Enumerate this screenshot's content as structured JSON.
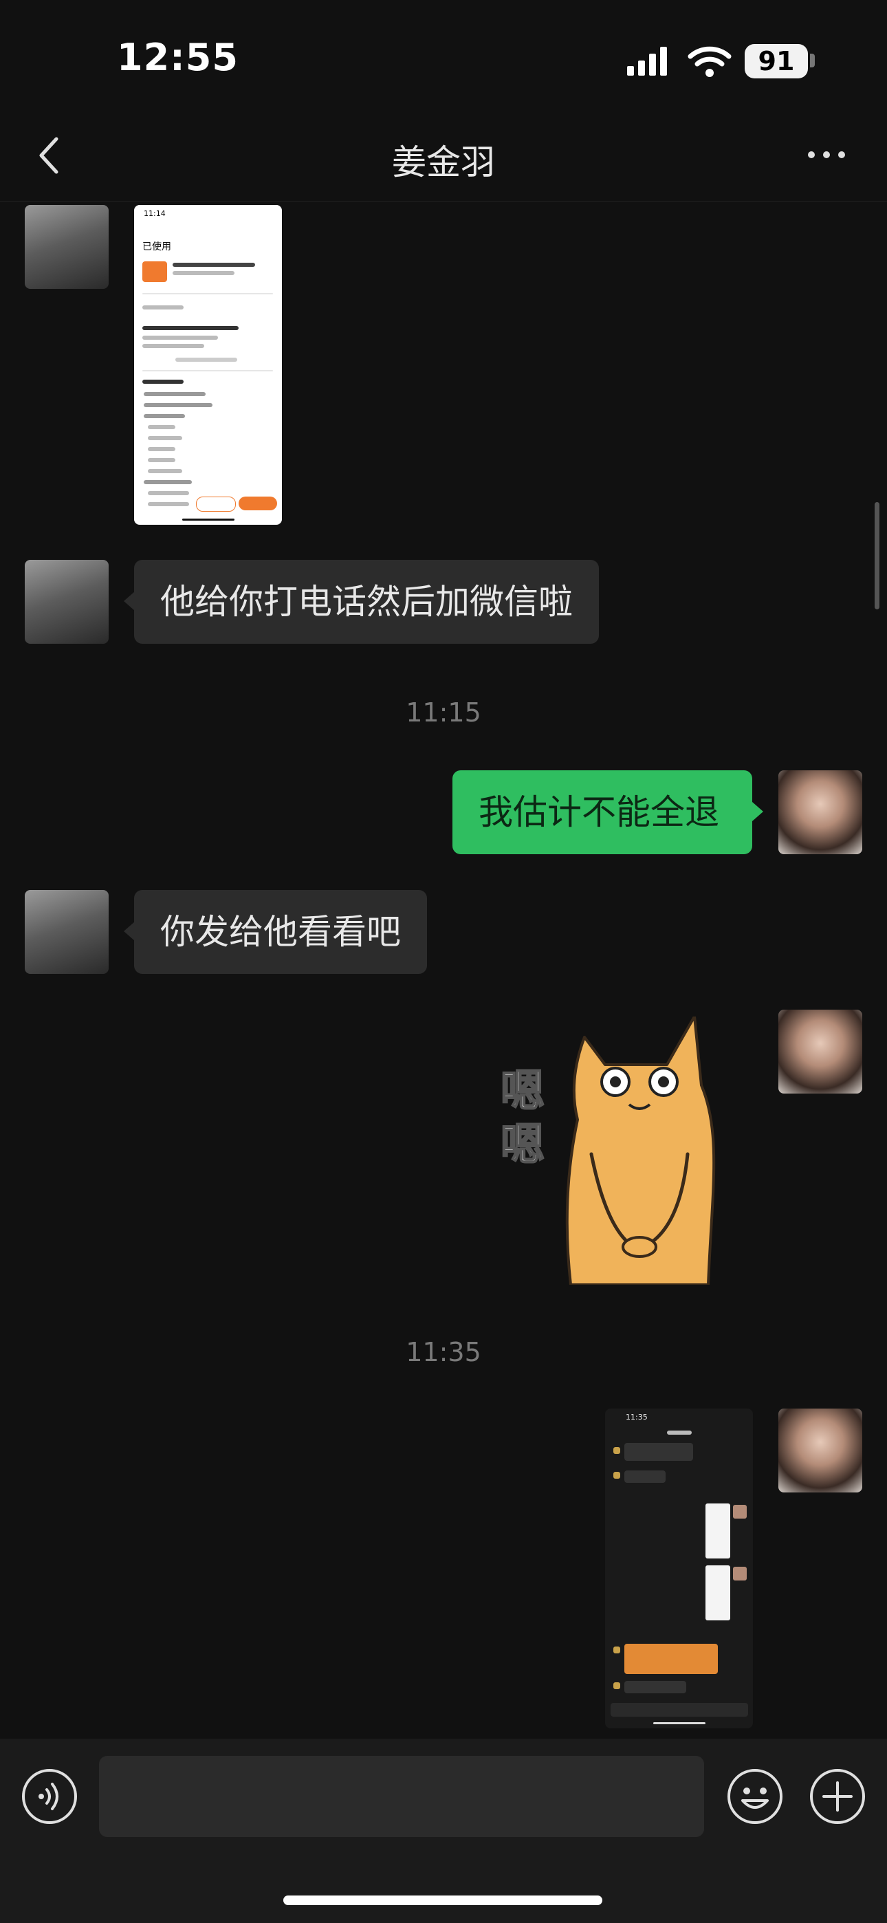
{
  "status_bar": {
    "time": "12:55",
    "battery": "91"
  },
  "header": {
    "title": "姜金羽"
  },
  "messages": [
    {
      "side": "left",
      "type": "image"
    },
    {
      "side": "left",
      "type": "text",
      "text": "他给你打电话然后加微信啦"
    },
    {
      "type": "timestamp",
      "text": "11:15"
    },
    {
      "side": "right",
      "type": "text",
      "text": "我估计不能全退"
    },
    {
      "side": "left",
      "type": "text",
      "text": "你发给他看看吧"
    },
    {
      "side": "right",
      "type": "sticker",
      "caption": "嗯嗯"
    },
    {
      "type": "timestamp",
      "text": "11:35"
    },
    {
      "side": "right",
      "type": "image"
    }
  ],
  "screenshot_1": {
    "time": "11:14",
    "status": "已使用"
  },
  "screenshot_2": {
    "time": "11:35"
  },
  "icons": {
    "back": "back-chevron-icon",
    "more": "more-dots-icon",
    "voice": "voice-icon",
    "emoji": "emoji-icon",
    "plus": "plus-icon"
  },
  "colors": {
    "background": "#111111",
    "bubble_left": "#2c2c2c",
    "bubble_right": "#2fbe60",
    "orange": "#f07a2e"
  }
}
